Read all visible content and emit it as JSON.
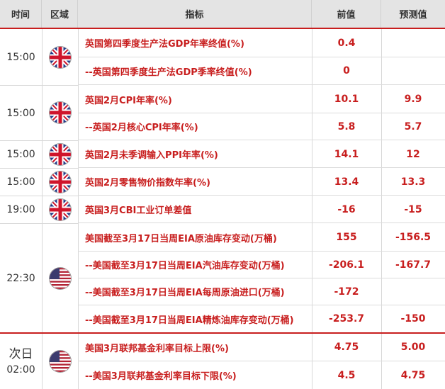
{
  "header": {
    "time": "时间",
    "region": "区域",
    "indicator": "指标",
    "previous": "前值",
    "forecast": "预测值"
  },
  "groups": [
    {
      "time": "15:00",
      "flag": "uk-flag-icon",
      "rows": [
        {
          "indicator": "英国第四季度生产法GDP年率终值(%)",
          "previous": "0.4",
          "forecast": ""
        },
        {
          "indicator": "--英国第四季度生产法GDP季率终值(%)",
          "previous": "0",
          "forecast": ""
        }
      ]
    },
    {
      "time": "15:00",
      "flag": "uk-flag-icon",
      "rows": [
        {
          "indicator": "英国2月CPI年率(%)",
          "previous": "10.1",
          "forecast": "9.9"
        },
        {
          "indicator": "--英国2月核心CPI年率(%)",
          "previous": "5.8",
          "forecast": "5.7"
        }
      ]
    },
    {
      "time": "15:00",
      "flag": "uk-flag-icon",
      "rows": [
        {
          "indicator": "英国2月未季调输入PPI年率(%)",
          "previous": "14.1",
          "forecast": "12"
        }
      ]
    },
    {
      "time": "15:00",
      "flag": "uk-flag-icon",
      "rows": [
        {
          "indicator": "英国2月零售物价指数年率(%)",
          "previous": "13.4",
          "forecast": "13.3"
        }
      ]
    },
    {
      "time": "19:00",
      "flag": "uk-flag-icon",
      "rows": [
        {
          "indicator": "英国3月CBI工业订单差值",
          "previous": "-16",
          "forecast": "-15"
        }
      ]
    },
    {
      "time": "22:30",
      "flag": "us-flag-icon",
      "rows": [
        {
          "indicator": "美国截至3月17日当周EIA原油库存变动(万桶)",
          "previous": "155",
          "forecast": "-156.5"
        },
        {
          "indicator": "--美国截至3月17日当周EIA汽油库存变动(万桶)",
          "previous": "-206.1",
          "forecast": "-167.7"
        },
        {
          "indicator": "--美国截至3月17日当周EIA每周原油进口(万桶)",
          "previous": "-172",
          "forecast": ""
        },
        {
          "indicator": "--美国截至3月17日当周EIA精炼油库存变动(万桶)",
          "previous": "-253.7",
          "forecast": "-150"
        }
      ]
    },
    {
      "next_day": "次日",
      "time": "02:00",
      "flag": "us-flag-icon",
      "rows": [
        {
          "indicator": "美国3月联邦基金利率目标上限(%)",
          "previous": "4.75",
          "forecast": "5.00"
        },
        {
          "indicator": "--美国3月联邦基金利率目标下限(%)",
          "previous": "4.5",
          "forecast": "4.75"
        }
      ]
    }
  ]
}
